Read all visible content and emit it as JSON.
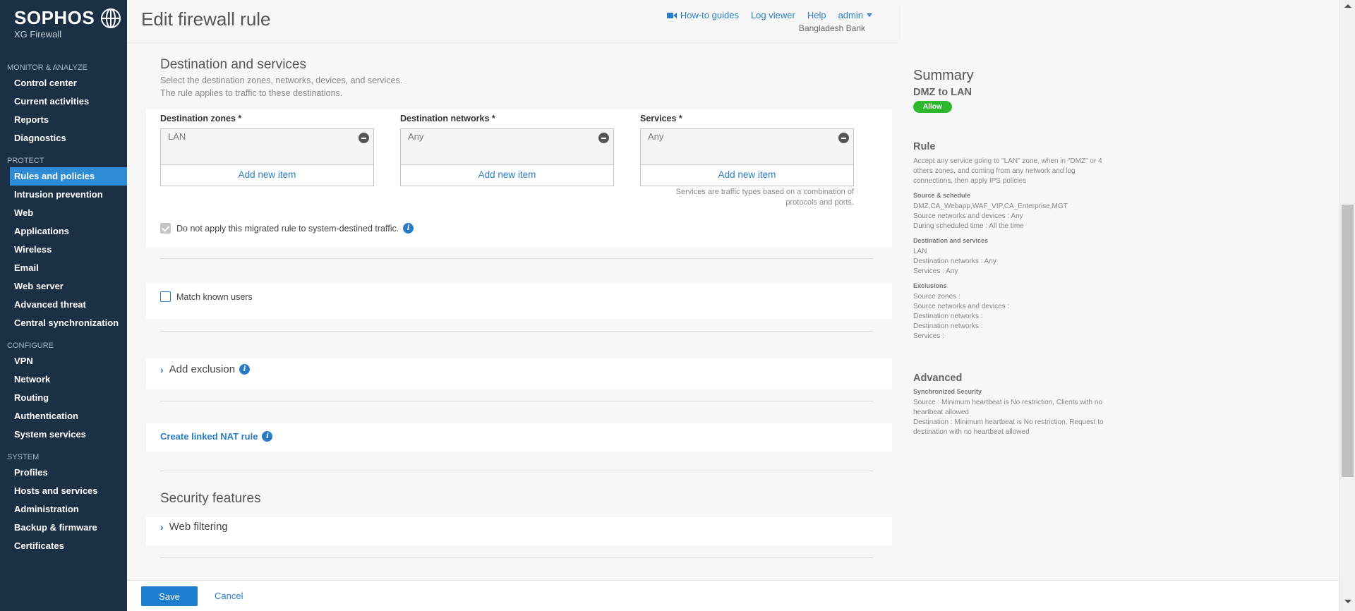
{
  "brand": {
    "name": "SOPHOS",
    "product": "XG Firewall"
  },
  "sidebar": {
    "sections": [
      {
        "title": "MONITOR & ANALYZE",
        "items": [
          "Control center",
          "Current activities",
          "Reports",
          "Diagnostics"
        ]
      },
      {
        "title": "PROTECT",
        "items": [
          "Rules and policies",
          "Intrusion prevention",
          "Web",
          "Applications",
          "Wireless",
          "Email",
          "Web server",
          "Advanced threat",
          "Central synchronization"
        ]
      },
      {
        "title": "CONFIGURE",
        "items": [
          "VPN",
          "Network",
          "Routing",
          "Authentication",
          "System services"
        ]
      },
      {
        "title": "SYSTEM",
        "items": [
          "Profiles",
          "Hosts and services",
          "Administration",
          "Backup & firmware",
          "Certificates"
        ]
      }
    ],
    "active_item": "Rules and policies"
  },
  "header": {
    "title": "Edit firewall rule",
    "links": {
      "howto": "How-to guides",
      "log": "Log viewer",
      "help": "Help",
      "user": "admin"
    },
    "org": "Bangladesh Bank"
  },
  "destination": {
    "title": "Destination and services",
    "desc1": "Select the destination zones, networks, devices, and services.",
    "desc2": "The rule applies to traffic to these destinations.",
    "zones_label": "Destination zones *",
    "zones_value": "LAN",
    "networks_label": "Destination networks *",
    "networks_value": "Any",
    "services_label": "Services *",
    "services_value": "Any",
    "add_label": "Add new item",
    "services_note1": "Services are traffic types based on a combination of",
    "services_note2": "protocols and ports.",
    "migrated_label": "Do not apply this migrated rule to system-destined traffic."
  },
  "match_users_label": "Match known users",
  "add_exclusion_label": "Add exclusion",
  "linked_nat_label": "Create linked NAT rule",
  "security": {
    "title": "Security features",
    "web_filtering": "Web filtering"
  },
  "summary": {
    "title": "Summary",
    "rule_name": "DMZ to LAN",
    "action": "Allow",
    "rule_heading": "Rule",
    "rule_text1": "Accept any service going to \"LAN\" zone, when in \"DMZ\" or 4",
    "rule_text2": "others zones, and coming from any network and log",
    "rule_text3": "connections, then apply IPS policies",
    "source_heading": "Source & schedule",
    "source_zones": "DMZ,CA_Webapp,WAF_VIP,CA_Enterprise,MGT",
    "source_networks": "Source networks and devices : Any",
    "schedule": "During scheduled time : All the time",
    "dest_heading": "Destination and services",
    "dest_zone": "LAN",
    "dest_networks": "Destination networks : Any",
    "dest_services": "Services : Any",
    "excl_heading": "Exclusions",
    "excl_source_zones": "Source zones :",
    "excl_source_networks": "Source networks and devices :",
    "excl_dest_networks1": "Destination networks :",
    "excl_dest_networks2": "Destination networks :",
    "excl_services": "Services :",
    "adv_heading": "Advanced",
    "sync_heading": "Synchronized Security",
    "sync_source1": "Source : Minimum heartbeat is No restriction, Clients with no",
    "sync_source2": "heartbeat allowed",
    "sync_dest1": "Destination : Minimum heartbeat is No restriction, Request to",
    "sync_dest2": "destination with no heartbeat allowed"
  },
  "footer": {
    "save": "Save",
    "cancel": "Cancel"
  },
  "colors": {
    "sidebar": "#1b2f45",
    "accent": "#2a7cc7",
    "active": "#2e8bd6",
    "allow": "#2eb82e"
  }
}
